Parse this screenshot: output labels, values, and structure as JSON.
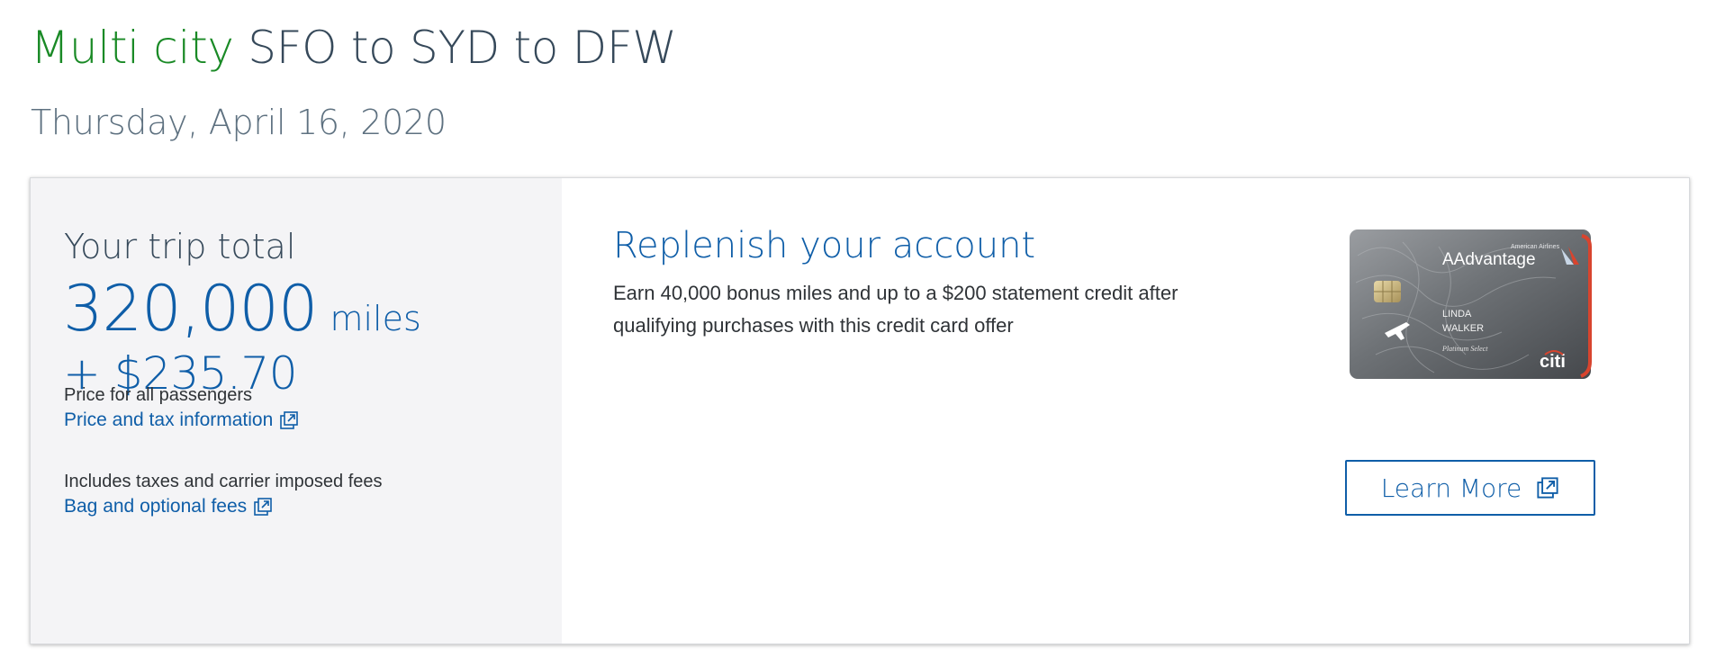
{
  "header": {
    "trip_type": "Multi city",
    "route": "SFO to SYD to DFW",
    "date": "Thursday, April 16, 2020"
  },
  "total": {
    "heading": "Your trip total",
    "miles_amount": "320,000",
    "miles_unit": "miles",
    "cash": "+ $235.70",
    "passengers_note": "Price for all passengers",
    "price_tax_link": "Price and tax information",
    "fees_note": "Includes taxes and carrier imposed fees",
    "bag_fees_link": "Bag and optional fees"
  },
  "promo": {
    "title": "Replenish your account",
    "body": "Earn 40,000 bonus miles and up to a $200 statement credit after qualifying purchases with this credit card offer",
    "learn_more_label": "Learn More",
    "card": {
      "brand_small": "American Airlines",
      "brand": "AAdvantage",
      "holder_first": "LINDA",
      "holder_last": "WALKER",
      "product": "Platinum Select",
      "issuer": "citi"
    }
  },
  "icons": {
    "external_link": "external-link-icon"
  },
  "colors": {
    "accent_blue": "#0f5ea8",
    "trip_type_green": "#1a8a26",
    "heading_slate": "#36495a",
    "panel_gray": "#f4f4f6"
  }
}
